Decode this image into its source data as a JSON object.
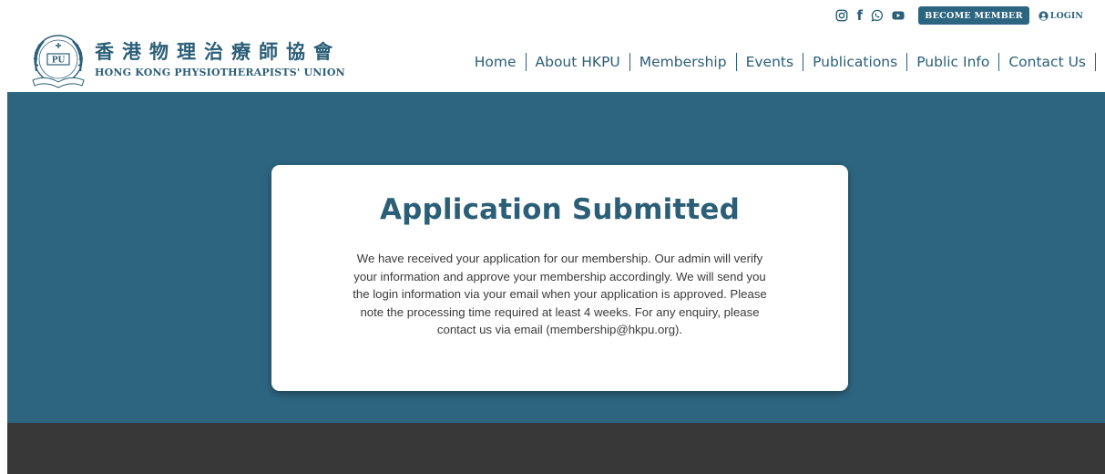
{
  "utility": {
    "social": [
      "instagram-icon",
      "facebook-icon",
      "whatsapp-icon",
      "youtube-icon"
    ],
    "facebook_glyph": "f",
    "become_member": "BECOME MEMBER",
    "login": "LOGIN"
  },
  "brand": {
    "name_zh": "香港物理治療師協會",
    "name_en": "HONG KONG PHYSIOTHERAPISTS' UNION",
    "logo_text": "PU"
  },
  "nav": {
    "items": [
      "Home",
      "About HKPU",
      "Membership",
      "Events",
      "Publications",
      "Public Info",
      "Contact Us"
    ]
  },
  "card": {
    "title": "Application Submitted",
    "body": "We have received your application for our membership. Our admin will verify your information and approve your membership accordingly. We will send you the login information via your email when your application is approved. Please note the processing time required at least 4 weeks. For any enquiry, please contact us via email (membership@hkpu.org)."
  },
  "colors": {
    "brand": "#2b5f78",
    "band": "#2d6580",
    "footer": "#383838"
  }
}
